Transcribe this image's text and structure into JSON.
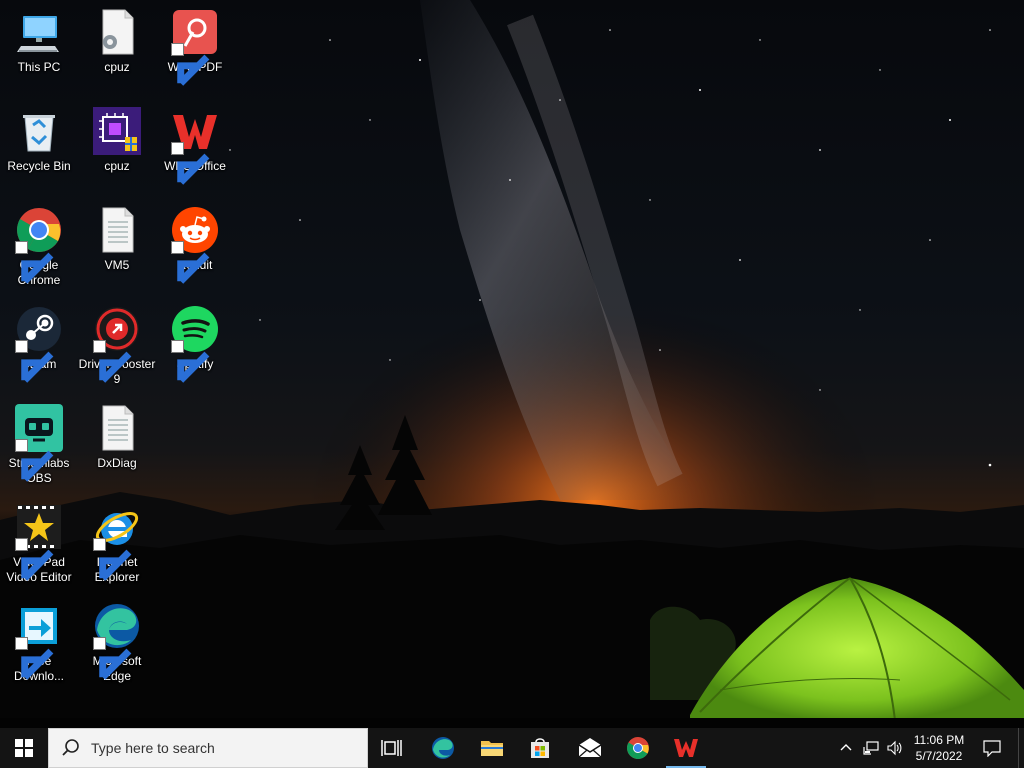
{
  "desktop": {
    "icons": [
      {
        "label": "This PC",
        "icon": "computer-icon"
      },
      {
        "label": "cpuz",
        "icon": "settings-file-icon"
      },
      {
        "label": "WPS PDF",
        "icon": "wps-pdf-icon"
      },
      {
        "label": "Recycle Bin",
        "icon": "recycle-bin-icon"
      },
      {
        "label": "cpuz",
        "icon": "cpuz-icon"
      },
      {
        "label": "WPS Office",
        "icon": "wps-office-icon"
      },
      {
        "label": "Google Chrome",
        "icon": "chrome-icon"
      },
      {
        "label": "VM5",
        "icon": "text-file-icon"
      },
      {
        "label": "Reddit",
        "icon": "reddit-icon"
      },
      {
        "label": "Steam",
        "icon": "steam-icon"
      },
      {
        "label": "Driver Booster 9",
        "icon": "driver-booster-icon"
      },
      {
        "label": "Spotify",
        "icon": "spotify-icon"
      },
      {
        "label": "Streamlabs OBS",
        "icon": "streamlabs-icon"
      },
      {
        "label": "DxDiag",
        "icon": "text-file-icon"
      },
      {
        "label": "VideoPad Video Editor",
        "icon": "videopad-icon"
      },
      {
        "label": "Internet Explorer",
        "icon": "internet-explorer-icon"
      },
      {
        "label": "Free Downlo...",
        "icon": "free-download-icon"
      },
      {
        "label": "Microsoft Edge",
        "icon": "edge-icon"
      }
    ]
  },
  "taskbar": {
    "start": {
      "icon": "windows-logo-icon"
    },
    "search": {
      "placeholder": "Type here to search",
      "icon": "search-icon"
    },
    "pinned": [
      {
        "name": "task-view",
        "icon": "task-view-icon"
      },
      {
        "name": "microsoft-edge",
        "icon": "edge-icon"
      },
      {
        "name": "file-explorer",
        "icon": "folder-icon"
      },
      {
        "name": "microsoft-store",
        "icon": "store-icon"
      },
      {
        "name": "mail",
        "icon": "mail-icon"
      },
      {
        "name": "google-chrome",
        "icon": "chrome-icon"
      },
      {
        "name": "wps-office",
        "icon": "wps-office-icon",
        "active": true
      }
    ],
    "tray": {
      "icons": [
        "chevron-up-icon",
        "network-icon",
        "volume-icon"
      ],
      "time": "11:06 PM",
      "date": "5/7/2022",
      "notification_icon": "notification-icon"
    }
  },
  "colors": {
    "taskbar": "#141414",
    "active_indicator": "#76b9ed",
    "tent": "#8fd12c",
    "horizon_glow": "#e8701c"
  }
}
